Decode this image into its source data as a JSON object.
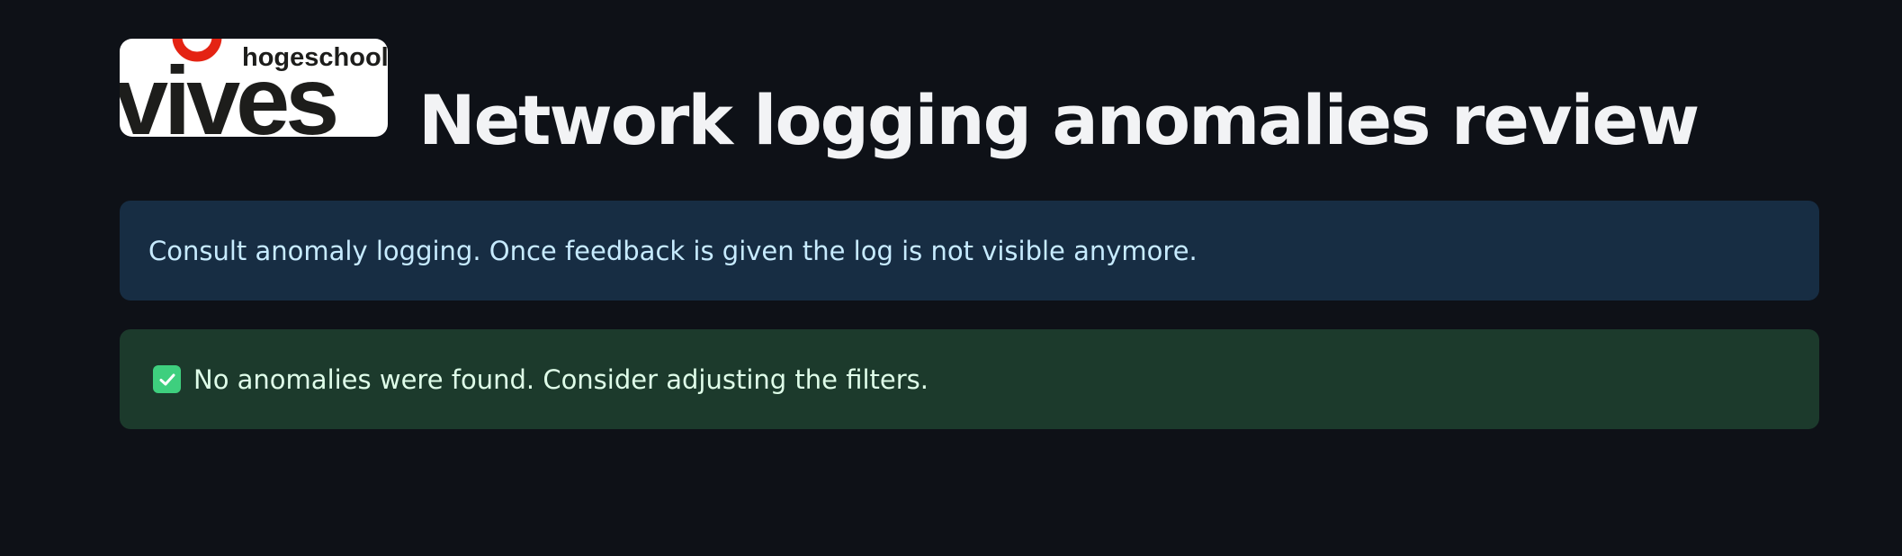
{
  "logo": {
    "wordmark": "vives",
    "tagline": "hogeschool",
    "accent_color": "#e42313"
  },
  "page": {
    "title": "Network logging anomalies review"
  },
  "info_alert": {
    "message": "Consult anomaly logging. Once feedback is given the log is not visible anymore.",
    "color": "#172d43"
  },
  "success_alert": {
    "icon": "check-icon",
    "message": "No anomalies were found. Consider adjusting the filters.",
    "color": "#1c3a2c"
  }
}
